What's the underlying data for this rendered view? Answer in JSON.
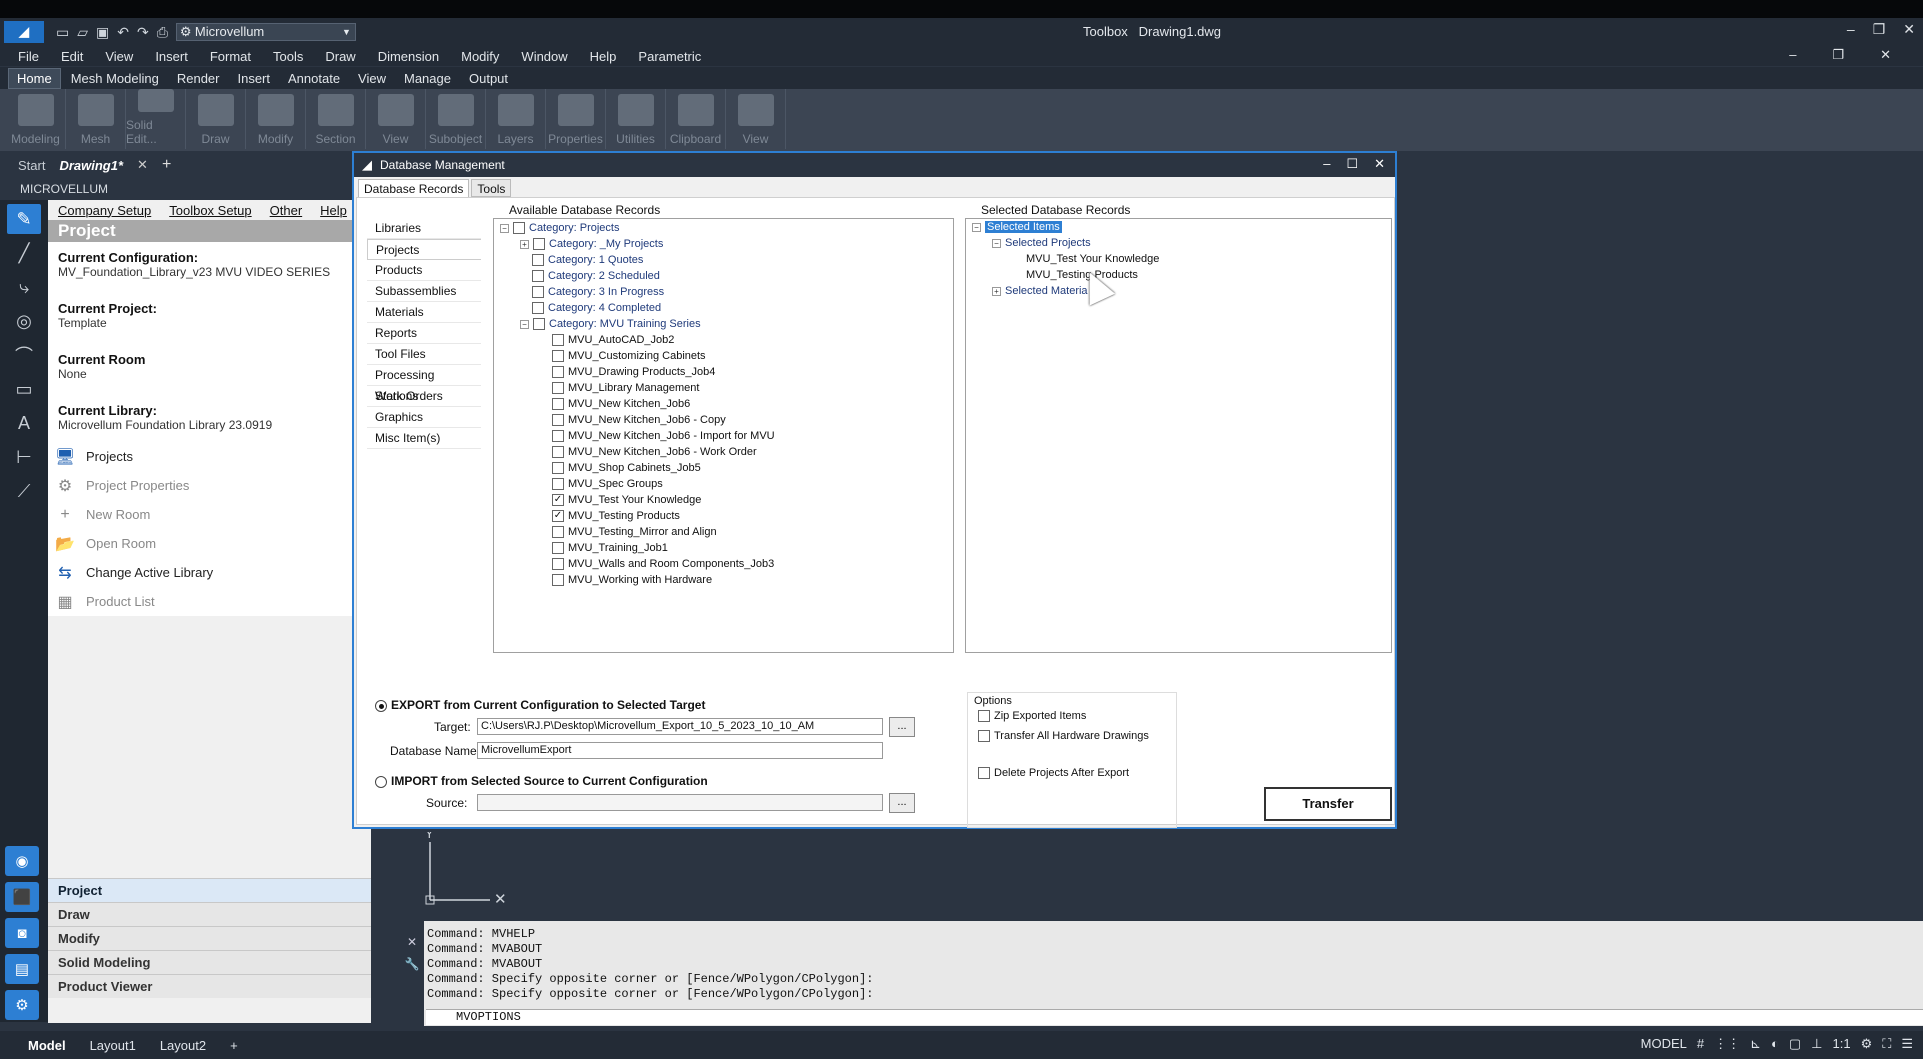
{
  "app": {
    "title_tool": "Toolbox",
    "title_file": "Drawing1.dwg",
    "workspace": "Microvellum"
  },
  "menubar": [
    "File",
    "Edit",
    "View",
    "Insert",
    "Format",
    "Tools",
    "Draw",
    "Dimension",
    "Modify",
    "Window",
    "Help",
    "Parametric"
  ],
  "ribbon_tabs": [
    "Home",
    "Mesh Modeling",
    "Render",
    "Insert",
    "Annotate",
    "View",
    "Manage",
    "Output"
  ],
  "ribbon_groups": [
    "Modeling",
    "Mesh",
    "Solid Edit...",
    "Draw",
    "Modify",
    "Section",
    "View",
    "Subobject",
    "Layers",
    "Properties",
    "Utilities",
    "Clipboard",
    "View"
  ],
  "doc_tabs": {
    "start": "Start",
    "drawing": "Drawing1*"
  },
  "palette": {
    "header": "MICROVELLUM",
    "menu": [
      "Company Setup",
      "Toolbox Setup",
      "Other",
      "Help"
    ],
    "title": "Project",
    "config_label": "Current Configuration:",
    "config_value": "MV_Foundation_Library_v23 MVU VIDEO SERIES",
    "project_label": "Current Project:",
    "project_value": "Template",
    "room_label": "Current Room",
    "room_value": "None",
    "library_label": "Current Library:",
    "library_value": "Microvellum Foundation Library 23.0919",
    "items": [
      {
        "label": "Projects",
        "icon": "monitor-icon",
        "dim": false
      },
      {
        "label": "Project Properties",
        "icon": "gear-icon",
        "dim": true
      },
      {
        "label": "New Room",
        "icon": "plus-icon",
        "dim": true
      },
      {
        "label": "Open Room",
        "icon": "folder-icon",
        "dim": true
      },
      {
        "label": "Change Active Library",
        "icon": "swap-icon",
        "dim": false
      },
      {
        "label": "Product List",
        "icon": "grid-icon",
        "dim": true
      }
    ],
    "nav": [
      "Project",
      "Draw",
      "Modify",
      "Solid Modeling",
      "Product Viewer"
    ]
  },
  "command": {
    "lines": [
      "Command: MVHELP",
      "Command: MVABOUT",
      "Command: MVABOUT",
      "Command: Specify opposite corner or [Fence/WPolygon/CPolygon]:",
      "Command: Specify opposite corner or [Fence/WPolygon/CPolygon]:"
    ],
    "input": "MVOPTIONS"
  },
  "statusbar": {
    "tabs": [
      "Model",
      "Layout1",
      "Layout2"
    ],
    "model_label": "MODEL",
    "scale": "1:1"
  },
  "dialog": {
    "title": "Database Management",
    "tabs": [
      "Database Records",
      "Tools"
    ],
    "available_header": "Available Database Records",
    "selected_header": "Selected Database Records",
    "nav": [
      "Libraries",
      "Projects",
      "Products",
      "Subassemblies",
      "Materials",
      "Reports",
      "Tool Files",
      "Processing Stations",
      "Work Orders",
      "Graphics",
      "Misc Item(s)"
    ],
    "tree": {
      "root": "Category: Projects",
      "categories": [
        "Category: _My Projects",
        "Category: 1 Quotes",
        "Category: 2 Scheduled",
        "Category: 3 In Progress",
        "Category: 4 Completed",
        "Category: MVU Training Series"
      ],
      "items": [
        {
          "label": "MVU_AutoCAD_Job2",
          "checked": false
        },
        {
          "label": "MVU_Customizing Cabinets",
          "checked": false
        },
        {
          "label": "MVU_Drawing Products_Job4",
          "checked": false
        },
        {
          "label": "MVU_Library Management",
          "checked": false
        },
        {
          "label": "MVU_New Kitchen_Job6",
          "checked": false
        },
        {
          "label": "MVU_New Kitchen_Job6 - Copy",
          "checked": false
        },
        {
          "label": "MVU_New Kitchen_Job6 - Import for MVU",
          "checked": false
        },
        {
          "label": "MVU_New Kitchen_Job6 - Work Order",
          "checked": false
        },
        {
          "label": "MVU_Shop Cabinets_Job5",
          "checked": false
        },
        {
          "label": "MVU_Spec Groups",
          "checked": false
        },
        {
          "label": "MVU_Test Your Knowledge",
          "checked": true
        },
        {
          "label": "MVU_Testing Products",
          "checked": true
        },
        {
          "label": "MVU_Testing_Mirror and Align",
          "checked": false
        },
        {
          "label": "MVU_Training_Job1",
          "checked": false
        },
        {
          "label": "MVU_Walls and Room Components_Job3",
          "checked": false
        },
        {
          "label": "MVU_Working with Hardware",
          "checked": false
        }
      ]
    },
    "selected_tree": {
      "root": "Selected Items",
      "projects": "Selected Projects",
      "children": [
        "MVU_Test Your Knowledge",
        "MVU_Testing Products"
      ],
      "materials": "Selected Materia"
    },
    "export_label": "EXPORT from Current Configuration to Selected Target",
    "target_label": "Target:",
    "target_value": "C:\\Users\\RJ.P\\Desktop\\Microvellum_Export_10_5_2023_10_10_AM",
    "dbname_label": "Database Name:",
    "dbname_value": "MicrovellumExport",
    "import_label": "IMPORT from Selected Source to Current Configuration",
    "source_label": "Source:",
    "source_value": "",
    "browse": "...",
    "options_title": "Options",
    "options": [
      {
        "label": "Zip Exported Items",
        "checked": false
      },
      {
        "label": "Transfer All Hardware Drawings",
        "checked": false
      },
      {
        "label": "Delete Projects After Export",
        "checked": false
      }
    ],
    "transfer_label": "Transfer"
  }
}
